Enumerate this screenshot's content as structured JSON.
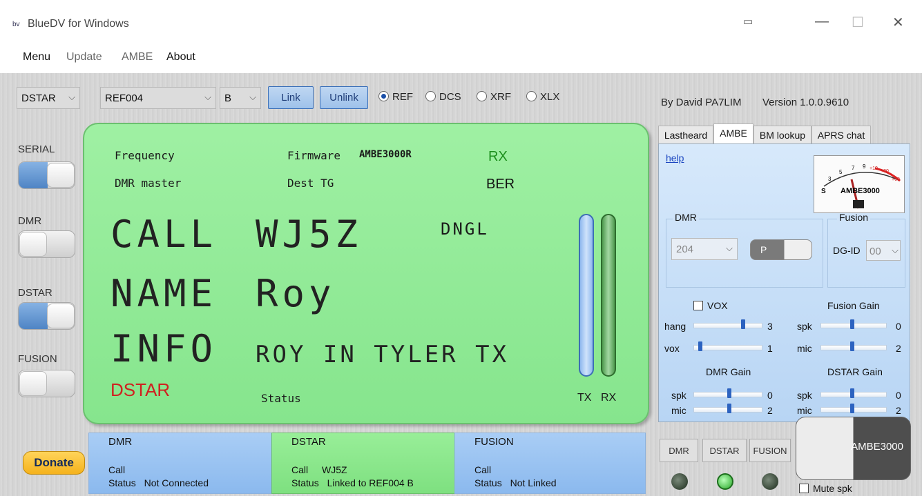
{
  "window": {
    "title": "BlueDV for Windows",
    "icon_text": "bv"
  },
  "menu": {
    "items": [
      "Menu",
      "Update",
      "AMBE",
      "About"
    ]
  },
  "toolbar": {
    "mode": "DSTAR",
    "reflector": "REF004",
    "module": "B",
    "link_label": "Link",
    "unlink_label": "Unlink",
    "radios": [
      {
        "label": "REF",
        "selected": true
      },
      {
        "label": "DCS",
        "selected": false
      },
      {
        "label": "XRF",
        "selected": false
      },
      {
        "label": "XLX",
        "selected": false
      }
    ],
    "author": "By David PA7LIM",
    "version": "Version 1.0.0.9610"
  },
  "side": {
    "toggles": [
      {
        "label": "SERIAL",
        "on": true
      },
      {
        "label": "DMR",
        "on": false
      },
      {
        "label": "DSTAR",
        "on": true
      },
      {
        "label": "FUSION",
        "on": false
      }
    ]
  },
  "lcd": {
    "frequency_label": "Frequency",
    "firmware_label": "Firmware",
    "firmware_value": "AMBE3000R",
    "rx": "RX",
    "dmr_master_label": "DMR master",
    "dest_tg_label": "Dest TG",
    "ber": "BER",
    "call_label": "CALL",
    "call_value": "WJ5Z",
    "dngl": "DNGL",
    "name_label": "NAME",
    "name_value": "Roy",
    "info_label": "INFO",
    "info_value": "ROY IN TYLER TX",
    "mode": "DSTAR",
    "status_label": "Status",
    "tx_label": "TX",
    "rx_label": "RX"
  },
  "tabs": [
    "Lastheard",
    "AMBE",
    "BM lookup",
    "APRS chat"
  ],
  "ambe": {
    "help": "help",
    "meter_label": "AMBE3000",
    "meter_scale": [
      "S",
      "3",
      "5",
      "7",
      "9",
      "+10",
      "+30",
      "+60"
    ],
    "dmr_label": "DMR",
    "dmr_value": "204",
    "p_label": "P",
    "fusion_label": "Fusion",
    "dgid_label": "DG-ID",
    "dgid_value": "00",
    "vox_label": "VOX",
    "fusion_gain": "Fusion Gain",
    "hang_label": "hang",
    "hang_value": "3",
    "vox_row_label": "vox",
    "vox_value": "1",
    "f_spk_label": "spk",
    "f_spk_value": "0",
    "f_mic_label": "mic",
    "f_mic_value": "2",
    "dmr_gain": "DMR Gain",
    "dstar_gain": "DSTAR Gain",
    "d_spk_label": "spk",
    "d_spk_value": "0",
    "d_mic_label": "mic",
    "d_mic_value": "2",
    "s_spk_label": "spk",
    "s_spk_value": "0",
    "s_mic_label": "mic",
    "s_mic_value": "2"
  },
  "bottom": {
    "donate": "Donate",
    "dmr": {
      "title": "DMR",
      "call_label": "Call",
      "call_value": "",
      "status_label": "Status",
      "status_value": "Not Connected"
    },
    "dstar": {
      "title": "DSTAR",
      "call_label": "Call",
      "call_value": "WJ5Z",
      "status_label": "Status",
      "status_value": "Linked to REF004 B"
    },
    "fusion": {
      "title": "FUSION",
      "call_label": "Call",
      "call_value": "",
      "status_label": "Status",
      "status_value": "Not Linked"
    },
    "mode_buttons": [
      "DMR",
      "DSTAR",
      "FUSION"
    ],
    "ambe_button": "AMBE3000",
    "mute_label": "Mute spk"
  },
  "colors": {
    "lcd_green": "#9ff0a3",
    "panel_blue": "#b8d5f4",
    "dstar_box": "#86e58d",
    "led_on": "#3ccc3c"
  }
}
